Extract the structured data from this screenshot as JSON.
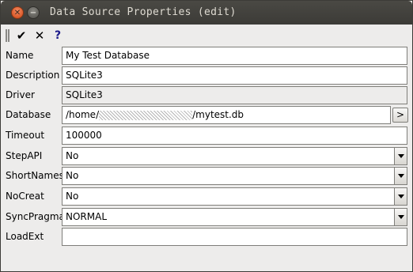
{
  "window": {
    "title": "Data Source Properties (edit)"
  },
  "toolbar": {
    "ok_glyph": "✔",
    "cancel_glyph": "✕",
    "help_glyph": "?"
  },
  "fields": {
    "name": {
      "label": "Name",
      "value": "My Test Database"
    },
    "description": {
      "label": "Description",
      "value": "SQLite3"
    },
    "driver": {
      "label": "Driver",
      "value": "SQLite3"
    },
    "database": {
      "label": "Database",
      "value_prefix": "/home/",
      "value_suffix": "/mytest.db",
      "browse_label": ">"
    },
    "timeout": {
      "label": "Timeout",
      "value": "100000"
    },
    "stepapi": {
      "label": "StepAPI",
      "value": "No"
    },
    "shortnames": {
      "label": "ShortNames",
      "value": "No"
    },
    "nocreat": {
      "label": "NoCreat",
      "value": "No"
    },
    "syncpragma": {
      "label": "SyncPragma",
      "value": "NORMAL"
    },
    "loadext": {
      "label": "LoadExt",
      "value": ""
    }
  }
}
